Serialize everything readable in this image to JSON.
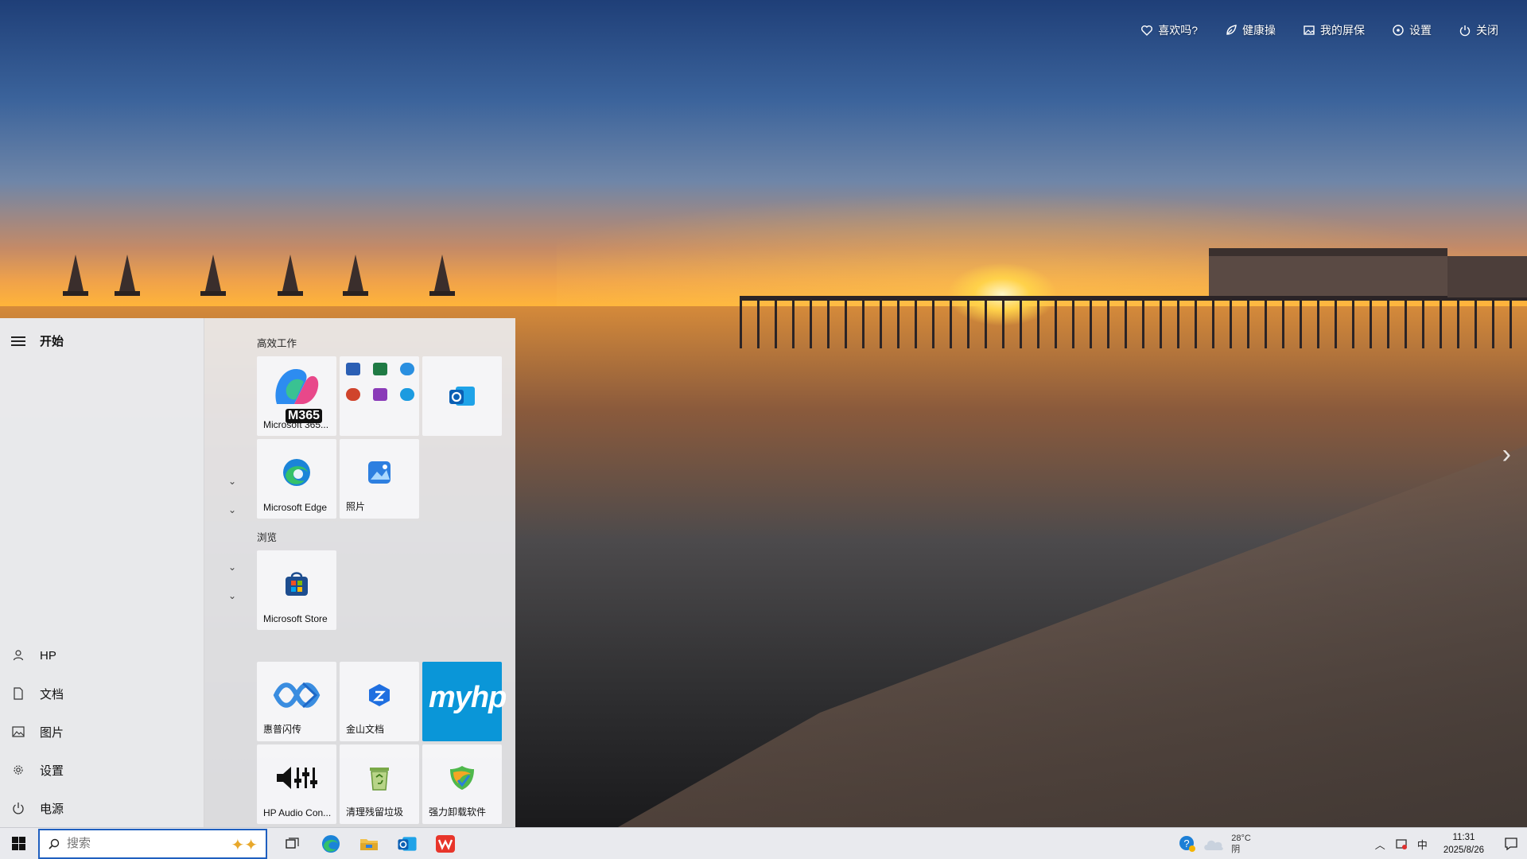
{
  "lockscreen_toolbar": [
    {
      "label": "喜欢吗?",
      "icon": "heart-icon"
    },
    {
      "label": "健康操",
      "icon": "leaf-icon"
    },
    {
      "label": "我的屏保",
      "icon": "image-icon"
    },
    {
      "label": "设置",
      "icon": "settings-icon"
    },
    {
      "label": "关闭",
      "icon": "power-icon"
    }
  ],
  "start_menu": {
    "title": "开始",
    "nav": [
      {
        "label": "HP",
        "icon": "user-icon"
      },
      {
        "label": "文档",
        "icon": "document-icon"
      },
      {
        "label": "图片",
        "icon": "pictures-icon"
      },
      {
        "label": "设置",
        "icon": "gear-icon"
      },
      {
        "label": "电源",
        "icon": "power-icon"
      }
    ],
    "groups": [
      {
        "label": "高效工作"
      },
      {
        "label": "浏览"
      }
    ],
    "tiles": {
      "m365": {
        "label": "Microsoft 365...",
        "badge": "M365"
      },
      "office_folder": {
        "label": ""
      },
      "outlook": {
        "label": ""
      },
      "edge": {
        "label": "Microsoft Edge"
      },
      "photos": {
        "label": "照片"
      },
      "store": {
        "label": "Microsoft Store"
      },
      "huipu": {
        "label": "惠普闪传"
      },
      "wps": {
        "label": "金山文档"
      },
      "myhp": {
        "label": "myhp"
      },
      "hp_audio": {
        "label": "HP Audio Con..."
      },
      "cleanup": {
        "label": "清理残留垃圾"
      },
      "uninstall": {
        "label": "强力卸载软件"
      }
    }
  },
  "taskbar": {
    "search_placeholder": "搜索",
    "weather_temp": "28°C",
    "weather_desc": "阴",
    "ime": "中",
    "time": "11:31",
    "date": "2025/8/26"
  }
}
